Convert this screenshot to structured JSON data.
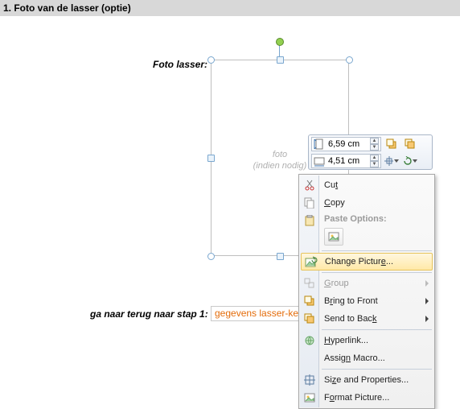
{
  "section": {
    "title": "1. Foto van de lasser (optie)"
  },
  "labels": {
    "foto_lasser": "Foto lasser:",
    "placeholder_line1": "foto",
    "placeholder_line2": "(indien nodig)",
    "go_back": "ga naar terug naar stap 1:",
    "go_back_link": "gegevens lasser-keu"
  },
  "mini_toolbar": {
    "height_value": "6,59 cm",
    "width_value": "4,51 cm"
  },
  "context_menu": {
    "cut": "Cut",
    "copy": "Copy",
    "paste_options": "Paste Options:",
    "change_picture": "Change Picture...",
    "group": "Group",
    "bring_front": "Bring to Front",
    "send_back": "Send to Back",
    "hyperlink": "Hyperlink...",
    "assign_macro": "Assign Macro...",
    "size_props": "Size and Properties...",
    "format_picture": "Format Picture..."
  }
}
